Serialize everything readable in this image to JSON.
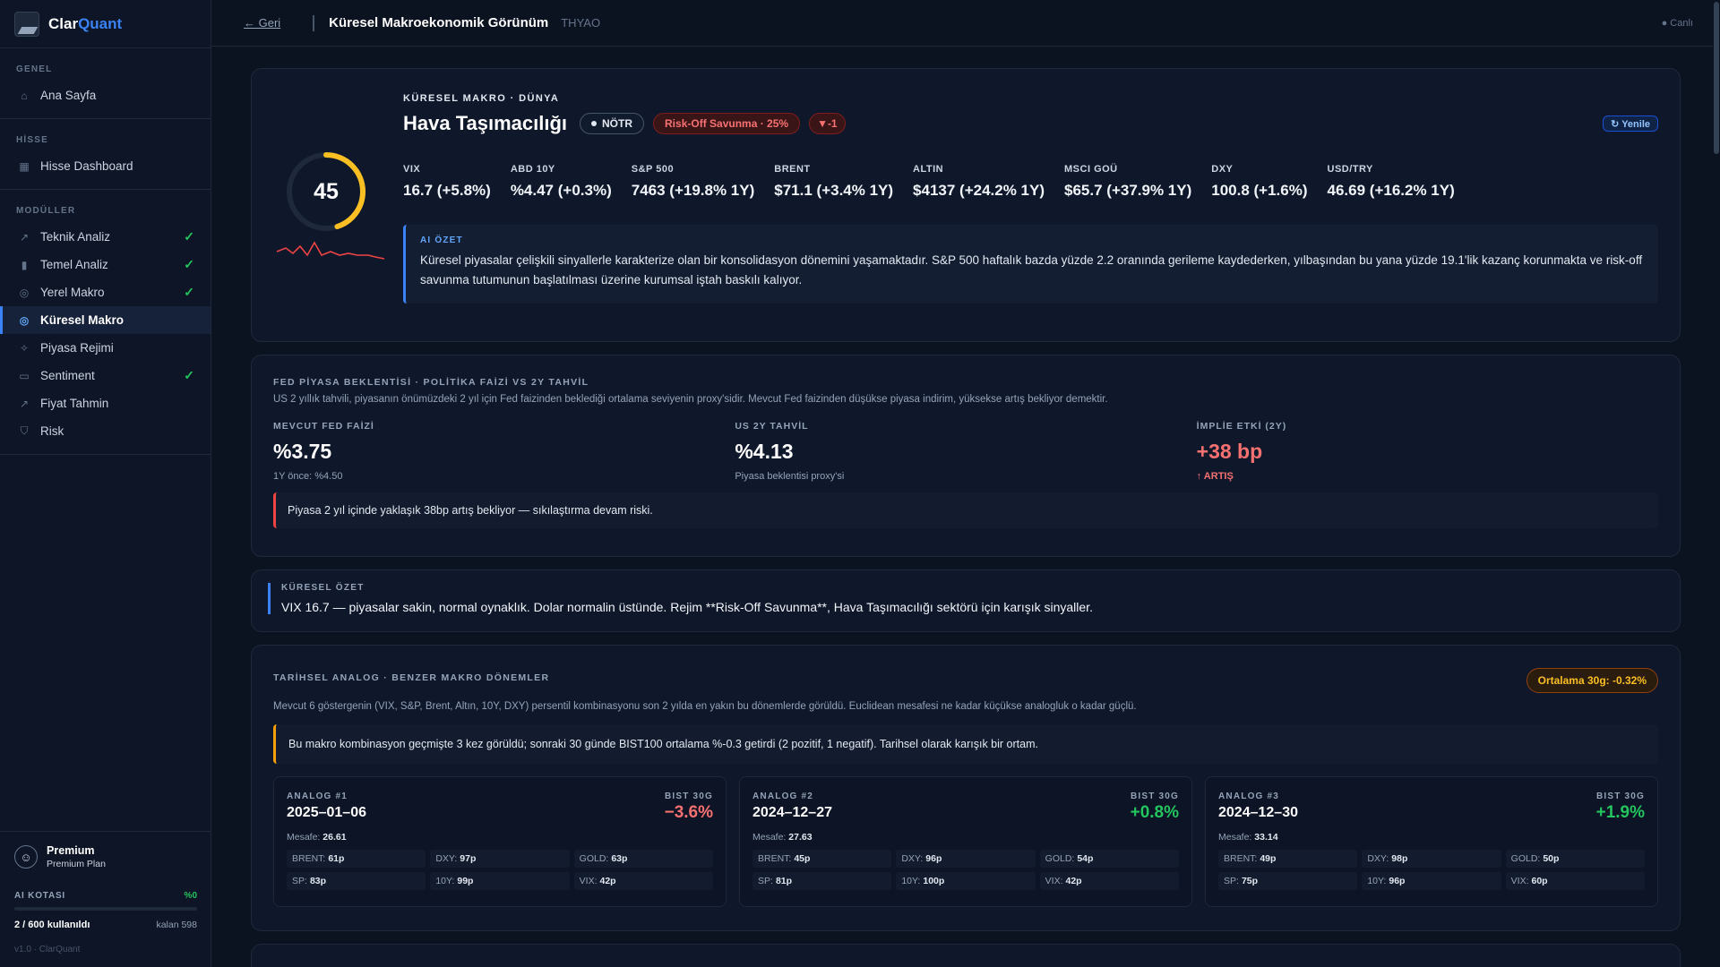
{
  "brand": {
    "name_a": "Clar",
    "name_b": "Quant"
  },
  "sidebar": {
    "sections": [
      {
        "label": "GENEL",
        "items": [
          {
            "label": "Ana Sayfa",
            "icon": "home-icon",
            "check": false,
            "active": false
          }
        ]
      },
      {
        "label": "HİSSE",
        "items": [
          {
            "label": "Hisse Dashboard",
            "icon": "grid-icon",
            "check": false,
            "active": false
          }
        ]
      },
      {
        "label": "MODÜLLER",
        "items": [
          {
            "label": "Teknik Analiz",
            "icon": "trend-icon",
            "check": true,
            "active": false
          },
          {
            "label": "Temel Analiz",
            "icon": "bar-chart-icon",
            "check": true,
            "active": false
          },
          {
            "label": "Yerel Makro",
            "icon": "globe-icon",
            "check": true,
            "active": false
          },
          {
            "label": "Küresel Makro",
            "icon": "globe-icon",
            "check": false,
            "active": true
          },
          {
            "label": "Piyasa Rejimi",
            "icon": "compass-icon",
            "check": false,
            "active": false
          },
          {
            "label": "Sentiment",
            "icon": "chat-icon",
            "check": true,
            "active": false
          },
          {
            "label": "Fiyat Tahmin",
            "icon": "trend-icon",
            "check": false,
            "active": false
          },
          {
            "label": "Risk",
            "icon": "shield-icon",
            "check": false,
            "active": false
          }
        ]
      }
    ],
    "user": {
      "name": "Premium",
      "plan": "Premium Plan"
    },
    "quota": {
      "label": "AI KOTASI",
      "percent_text": "%0",
      "used_text": "2 / 600 kullanıldı",
      "remaining_text": "kalan 598",
      "fraction_used": 0.0033
    },
    "version": "v1.0 · ClarQuant"
  },
  "topbar": {
    "back": "← Geri",
    "title": "Küresel Makroekonomik Görünüm",
    "ticker": "THYAO",
    "live": "● Canlı"
  },
  "hero": {
    "kicker": "KÜRESEL MAKRO · DÜNYA",
    "sector": "Hava Taşımacılığı",
    "score": "45",
    "score_fraction": 0.45,
    "badge_neutral": "NÖTR",
    "badge_regime": "Risk-Off Savunma · 25%",
    "badge_delta": "▼-1",
    "refresh": "↻ Yenile",
    "metrics": [
      {
        "label": "VIX",
        "value": "16.7 (+5.8%)"
      },
      {
        "label": "ABD 10Y",
        "value": "%4.47 (+0.3%)"
      },
      {
        "label": "S&P 500",
        "value": "7463 (+19.8% 1Y)"
      },
      {
        "label": "BRENT",
        "value": "$71.1 (+3.4% 1Y)"
      },
      {
        "label": "ALTIN",
        "value": "$4137 (+24.2% 1Y)"
      },
      {
        "label": "MSCI GOÜ",
        "value": "$65.7 (+37.9% 1Y)"
      },
      {
        "label": "DXY",
        "value": "100.8 (+1.6%)"
      },
      {
        "label": "USD/TRY",
        "value": "46.69 (+16.2% 1Y)"
      }
    ],
    "ai_label": "AI ÖZET",
    "ai_text": "Küresel piyasalar çelişkili sinyallerle karakterize olan bir konsolidasyon dönemini yaşamaktadır. S&P 500 haftalık bazda yüzde 2.2 oranında gerileme kaydederken, yılbaşından bu yana yüzde 19.1'lik kazanç korunmakta ve risk-off savunma tutumunun başlatılması üzerine kurumsal iştah baskılı kalıyor."
  },
  "fed": {
    "kicker": "FED PİYASA BEKLENTİSİ · POLİTİKA FAİZİ VS 2Y TAHVİL",
    "desc": "US 2 yıllık tahvili, piyasanın önümüzdeki 2 yıl için Fed faizinden beklediği ortalama seviyenin proxy'sidir. Mevcut Fed faizinden düşükse piyasa indirim, yüksekse artış bekliyor demektir.",
    "cols": [
      {
        "label": "MEVCUT FED FAİZİ",
        "value": "%3.75",
        "sub": "1Y önce: %4.50"
      },
      {
        "label": "US 2Y TAHVİL",
        "value": "%4.13",
        "sub": "Piyasa beklentisi proxy'si"
      },
      {
        "label": "İMPLİE ETKİ (2Y)",
        "value": "+38 bp",
        "sub": "↑ ARTIŞ"
      }
    ],
    "note": "Piyasa 2 yıl içinde yaklaşık 38bp artış bekliyor — sıkılaştırma devam riski."
  },
  "summary": {
    "kicker": "KÜRESEL ÖZET",
    "text": "VIX 16.7 — piyasalar sakin, normal oynaklık. Dolar normalin üstünde. Rejim **Risk-Off Savunma**, Hava Taşımacılığı sektörü için karışık sinyaller."
  },
  "analog": {
    "kicker": "TARİHSEL ANALOG · BENZER MAKRO DÖNEMLER",
    "avg": "Ortalama 30g: -0.32%",
    "desc": "Mevcut 6 göstergenin (VIX, S&P, Brent, Altın, 10Y, DXY) persentil kombinasyonu son 2 yılda en yakın bu dönemlerde görüldü. Euclidean mesafesi ne kadar küçükse analogluk o kadar güçlü.",
    "note": "Bu makro kombinasyon geçmişte 3 kez görüldü; sonraki 30 günde BIST100 ortalama %-0.3 getirdi (2 pozitif, 1 negatif). Tarihsel olarak karışık bir ortam.",
    "items": [
      {
        "label": "ANALOG #1",
        "date": "2025–01–06",
        "ret_label": "BIST 30G",
        "ret": "−3.6%",
        "sign": "neg",
        "dist_label": "Mesafe:",
        "dist": "26.61",
        "chips": [
          [
            "BRENT:",
            "61p"
          ],
          [
            "DXY:",
            "97p"
          ],
          [
            "GOLD:",
            "63p"
          ],
          [
            "SP:",
            "83p"
          ],
          [
            "10Y:",
            "99p"
          ],
          [
            "VIX:",
            "42p"
          ]
        ]
      },
      {
        "label": "ANALOG #2",
        "date": "2024–12–27",
        "ret_label": "BIST 30G",
        "ret": "+0.8%",
        "sign": "pos",
        "dist_label": "Mesafe:",
        "dist": "27.63",
        "chips": [
          [
            "BRENT:",
            "45p"
          ],
          [
            "DXY:",
            "96p"
          ],
          [
            "GOLD:",
            "54p"
          ],
          [
            "SP:",
            "81p"
          ],
          [
            "10Y:",
            "100p"
          ],
          [
            "VIX:",
            "42p"
          ]
        ]
      },
      {
        "label": "ANALOG #3",
        "date": "2024–12–30",
        "ret_label": "BIST 30G",
        "ret": "+1.9%",
        "sign": "pos",
        "dist_label": "Mesafe:",
        "dist": "33.14",
        "chips": [
          [
            "BRENT:",
            "49p"
          ],
          [
            "DXY:",
            "98p"
          ],
          [
            "GOLD:",
            "50p"
          ],
          [
            "SP:",
            "75p"
          ],
          [
            "10Y:",
            "96p"
          ],
          [
            "VIX:",
            "60p"
          ]
        ]
      }
    ]
  },
  "colors": {
    "accent": "#3b82f6",
    "positive": "#22c55e",
    "negative": "#f87171",
    "gauge": "#fbbf24",
    "warning": "#f59e0b"
  }
}
